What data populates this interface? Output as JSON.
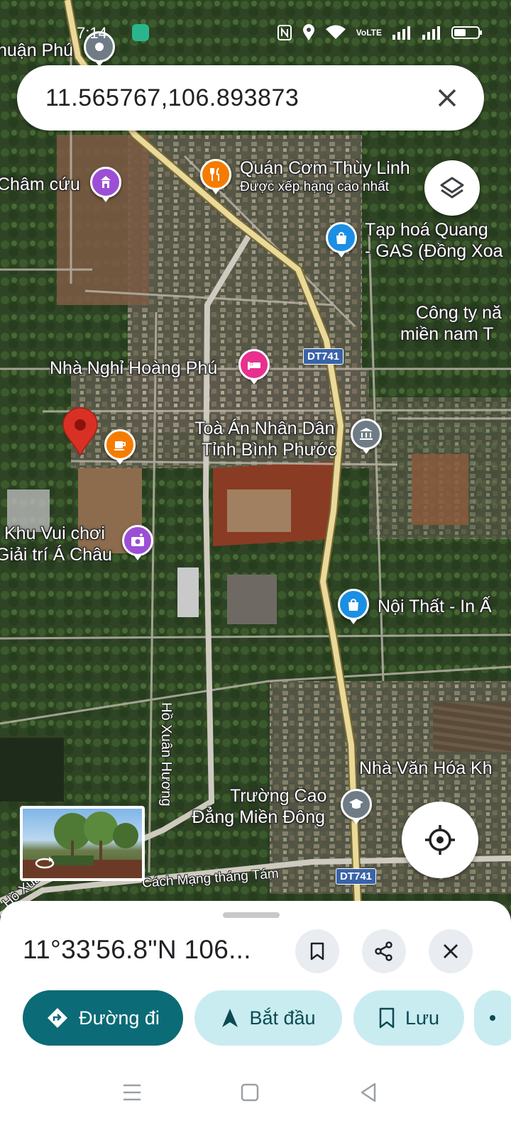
{
  "status_bar": {
    "time": "7:14",
    "network": "VoLTE"
  },
  "search": {
    "query": "11.565767,106.893873"
  },
  "map": {
    "places": [
      {
        "name": "huận Phú",
        "sub": ""
      },
      {
        "name": "Châm cứu",
        "sub": ""
      },
      {
        "name": "Quán Cơm Thùy Linh",
        "sub": "Được xếp hạng cao nhất"
      },
      {
        "name": "Tạp hoá Quang",
        "sub": "- GAS (Đồng Xoa"
      },
      {
        "name": "Công ty nă",
        "sub": "miền nam T"
      },
      {
        "name": "Nhà Nghỉ Hoàng Phú",
        "sub": ""
      },
      {
        "name": "Toà Án Nhân Dân",
        "sub": "Tỉnh Bình Phước"
      },
      {
        "name": "Khu Vui chơi",
        "sub": "Giải trí Á Châu"
      },
      {
        "name": "Nội Thất - In Ấ",
        "sub": ""
      },
      {
        "name": "Nhà Văn Hóa Kh",
        "sub": ""
      },
      {
        "name": "Trường Cao",
        "sub": "Đẳng Miền Đông"
      }
    ],
    "roads": {
      "dt741": "DT741",
      "ho_xuan_huong": "Hồ Xuân Hương",
      "cach_mang": "Cách Mạng tháng Tám",
      "ho_xuan_edge": "Hồ Xuân"
    },
    "colors": {
      "pin": "#d93025",
      "food": "#f57c00",
      "shop": "#1a8fe3",
      "purple": "#9c4fd6",
      "hotel": "#e8308e",
      "gov": "#6f7c86"
    }
  },
  "sheet": {
    "coordinates": "11°33'56.8\"N 106...",
    "actions": {
      "directions": "Đường đi",
      "start": "Bắt đầu",
      "save": "Lưu"
    }
  }
}
